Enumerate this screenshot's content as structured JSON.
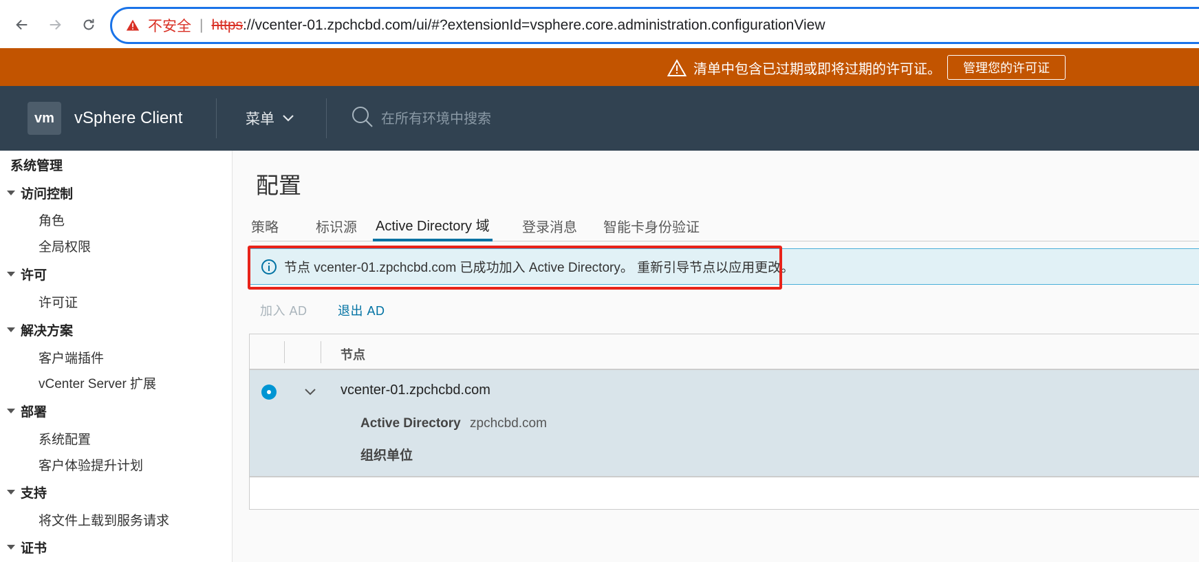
{
  "browser": {
    "insecure_label": "不安全",
    "separator": "|",
    "url_scheme": "https",
    "url_rest": "://vcenter-01.zpchcbd.com/ui/#?extensionId=vsphere.core.administration.configurationView"
  },
  "license_banner": {
    "message": "清单中包含已过期或即将过期的许可证。",
    "button_label": "管理您的许可证"
  },
  "header": {
    "logo_text": "vm",
    "app_title": "vSphere Client",
    "menu_label": "菜单",
    "search_placeholder": "在所有环境中搜索"
  },
  "sidebar": {
    "title": "系统管理",
    "groups": [
      {
        "label": "访问控制",
        "items": [
          "角色",
          "全局权限"
        ]
      },
      {
        "label": "许可",
        "items": [
          "许可证"
        ]
      },
      {
        "label": "解决方案",
        "items": [
          "客户端插件",
          "vCenter Server 扩展"
        ]
      },
      {
        "label": "部署",
        "items": [
          "系统配置",
          "客户体验提升计划"
        ]
      },
      {
        "label": "支持",
        "items": [
          "将文件上载到服务请求"
        ]
      },
      {
        "label": "证书",
        "items": []
      }
    ]
  },
  "main": {
    "page_title": "配置",
    "tabs": [
      "策略",
      "标识源",
      "Active Directory 域",
      "登录消息",
      "智能卡身份验证"
    ],
    "active_tab": "Active Directory 域",
    "info_message": "节点 vcenter-01.zpchcbd.com 已成功加入 Active Directory。 重新引导节点以应用更改。",
    "actions": {
      "join": "加入 AD",
      "leave": "退出 AD"
    },
    "grid": {
      "column_header": "节点",
      "row": {
        "node": "vcenter-01.zpchcbd.com",
        "details": [
          {
            "label": "Active Directory",
            "value": "zpchcbd.com"
          },
          {
            "label": "组织单位",
            "value": ""
          }
        ]
      }
    }
  },
  "colors": {
    "license_banner": "#c25400",
    "header_bg": "#314251",
    "accent": "#0072a3",
    "info_bg": "#e1f1f6",
    "highlight_box": "#e8231a"
  }
}
